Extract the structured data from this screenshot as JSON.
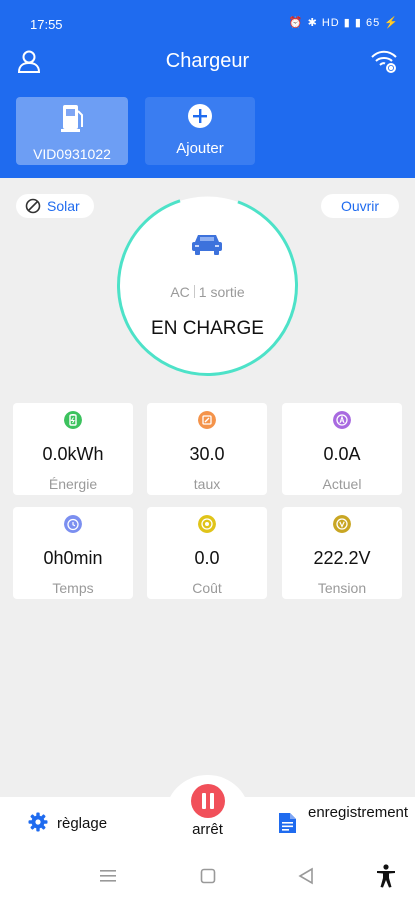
{
  "status_bar": {
    "time": "17:55",
    "icons": "⏰ ✱ HD ▮ ▮ 65 ⚡"
  },
  "header": {
    "title": "Chargeur"
  },
  "devices": [
    {
      "label": "VID0931022"
    }
  ],
  "add": {
    "label": "Ajouter"
  },
  "solar": {
    "label": "Solar"
  },
  "open": {
    "label": "Ouvrir"
  },
  "charger": {
    "type": "AC",
    "outputs": "1 sortie",
    "state": "EN CHARGE"
  },
  "metrics": [
    {
      "value": "0.0kWh",
      "label": "Énergie",
      "icon": "battery-icon",
      "color": "#3cc25e"
    },
    {
      "value": "30.0",
      "label": "taux",
      "icon": "rate-icon",
      "color": "#f4934a"
    },
    {
      "value": "0.0A",
      "label": "Actuel",
      "icon": "current-icon",
      "color": "#a86ae0"
    },
    {
      "value": "0h0min",
      "label": "Temps",
      "icon": "clock-icon",
      "color": "#7b8ff0"
    },
    {
      "value": "0.0",
      "label": "Coût",
      "icon": "coin-icon",
      "color": "#e0c419"
    },
    {
      "value": "222.2V",
      "label": "Tension",
      "icon": "voltage-icon",
      "color": "#c9a623"
    }
  ],
  "bottom": {
    "settings": "règlage",
    "stop": "arrêt",
    "records": "enregistrement"
  },
  "colors": {
    "primary": "#1f6bef",
    "accent": "#4de2c8",
    "stop": "#f1505a"
  }
}
